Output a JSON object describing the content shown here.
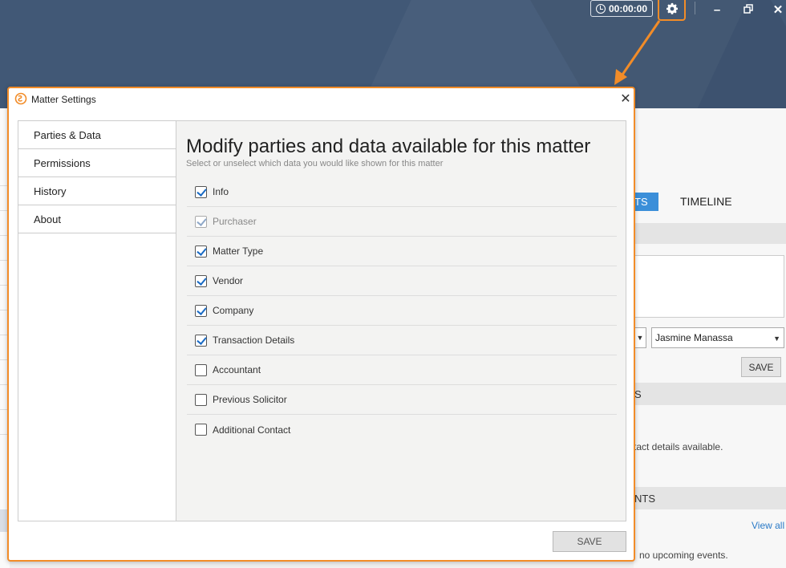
{
  "app": {
    "timer": "00:00:00",
    "icons": {
      "settings": "gear-icon",
      "timer": "clock-icon",
      "minimize": "minimize-icon",
      "restore": "restore-icon",
      "close": "close-icon"
    },
    "window_controls": {
      "minimize": "–",
      "restore": "🗗",
      "close": "✕"
    },
    "tab_partial": "TS",
    "tab_timeline": "TIMELINE",
    "section1_partial": "S",
    "section2_partial": "NTS",
    "assignee_value": "Jasmine Manassa",
    "save_label": "SAVE",
    "contact_text_partial": "tact details available.",
    "view_all": "View all",
    "events_text_partial": "no upcoming events.",
    "accent_color": "#f28c28",
    "header_color": "#415876"
  },
  "dialog": {
    "title": "Matter Settings",
    "close_symbol": "✕",
    "nav": [
      {
        "label": "Parties & Data"
      },
      {
        "label": "Permissions"
      },
      {
        "label": "History"
      },
      {
        "label": "About"
      }
    ],
    "heading": "Modify parties and data available for this matter",
    "subheading": "Select or unselect which data you would like shown for this matter",
    "items": [
      {
        "label": "Info",
        "checked": true,
        "disabled": false
      },
      {
        "label": "Purchaser",
        "checked": true,
        "disabled": true
      },
      {
        "label": "Matter Type",
        "checked": true,
        "disabled": false
      },
      {
        "label": "Vendor",
        "checked": true,
        "disabled": false
      },
      {
        "label": "Company",
        "checked": true,
        "disabled": false
      },
      {
        "label": "Transaction Details",
        "checked": true,
        "disabled": false
      },
      {
        "label": "Accountant",
        "checked": false,
        "disabled": false
      },
      {
        "label": "Previous Solicitor",
        "checked": false,
        "disabled": false
      },
      {
        "label": "Additional Contact",
        "checked": false,
        "disabled": false
      }
    ],
    "save_label": "SAVE"
  }
}
